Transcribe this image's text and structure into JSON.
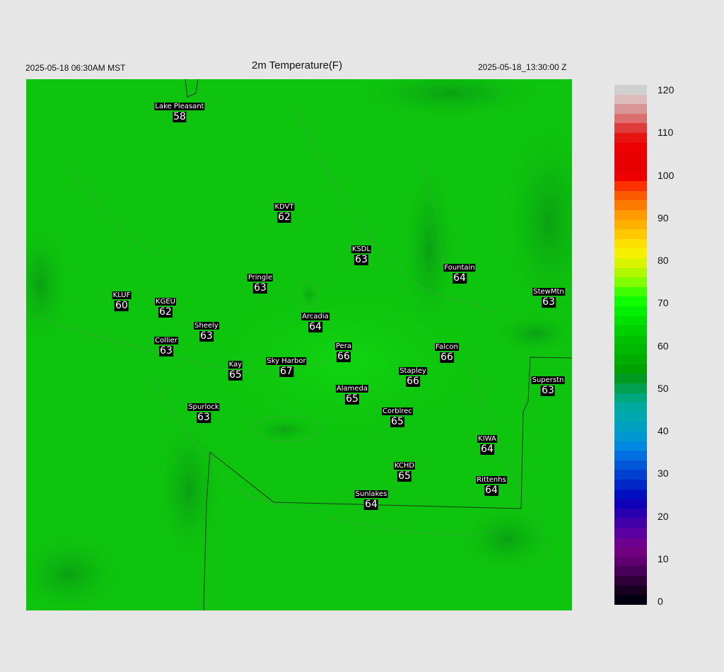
{
  "header": {
    "local_time": "2025-05-18 06:30AM MST",
    "title": "2m Temperature(F)",
    "utc_time": "2025-05-18_13:30:00 Z"
  },
  "colors": {
    "background": "#e6e6e6",
    "field_green": "#0dc30d",
    "field_dark_green": "#0a9a1a",
    "label_bg": "#000000",
    "label_text": "#ffffff"
  },
  "stations": [
    {
      "name": "Lake Pleasant",
      "value": "58"
    },
    {
      "name": "KDVT",
      "value": "62"
    },
    {
      "name": "KSDL",
      "value": "63"
    },
    {
      "name": "Fountain",
      "value": "64"
    },
    {
      "name": "Pringle",
      "value": "63"
    },
    {
      "name": "KLUF",
      "value": "60"
    },
    {
      "name": "KGEU",
      "value": "62"
    },
    {
      "name": "StewMtn",
      "value": "63"
    },
    {
      "name": "Arcadia",
      "value": "64"
    },
    {
      "name": "Sheely",
      "value": "63"
    },
    {
      "name": "Collier",
      "value": "63"
    },
    {
      "name": "Pera",
      "value": "66"
    },
    {
      "name": "Falcon",
      "value": "66"
    },
    {
      "name": "Kay",
      "value": "65"
    },
    {
      "name": "Sky Harbor",
      "value": "67"
    },
    {
      "name": "Stapley",
      "value": "66"
    },
    {
      "name": "Superstn",
      "value": "63"
    },
    {
      "name": "Alameda",
      "value": "65"
    },
    {
      "name": "Spurlock",
      "value": "63"
    },
    {
      "name": "Corblrec",
      "value": "65"
    },
    {
      "name": "KIWA",
      "value": "64"
    },
    {
      "name": "KCHD",
      "value": "65"
    },
    {
      "name": "Rittenhs",
      "value": "64"
    },
    {
      "name": "Sunlakes",
      "value": "64"
    }
  ],
  "colorbar": {
    "ticks": [
      "0",
      "10",
      "20",
      "30",
      "40",
      "50",
      "60",
      "70",
      "80",
      "90",
      "100",
      "110",
      "120"
    ],
    "colors_top_to_bottom": [
      "#d0d0d0",
      "#dcbcbc",
      "#d89696",
      "#dc6e6e",
      "#e03c3c",
      "#e81414",
      "#ee0000",
      "#e80000",
      "#e80000",
      "#ee0000",
      "#ff3000",
      "#ff5a00",
      "#ff7a00",
      "#ff9a00",
      "#ffb000",
      "#ffc800",
      "#ffe000",
      "#f4f000",
      "#d8f400",
      "#b0f800",
      "#80ff00",
      "#40ff00",
      "#10ff00",
      "#00f000",
      "#00e000",
      "#00d000",
      "#00c000",
      "#00b800",
      "#00ad00",
      "#00a200",
      "#009a20",
      "#00a050",
      "#00a880",
      "#00aaa0",
      "#00a8b0",
      "#00a0c0",
      "#0098d0",
      "#0088e0",
      "#0070e0",
      "#0058d8",
      "#0040d0",
      "#0028c8",
      "#0010c0",
      "#1000b8",
      "#2800b0",
      "#4000a8",
      "#5800a0",
      "#6c0090",
      "#700080",
      "#600070",
      "#480058",
      "#300038",
      "#180020",
      "#000010"
    ]
  }
}
